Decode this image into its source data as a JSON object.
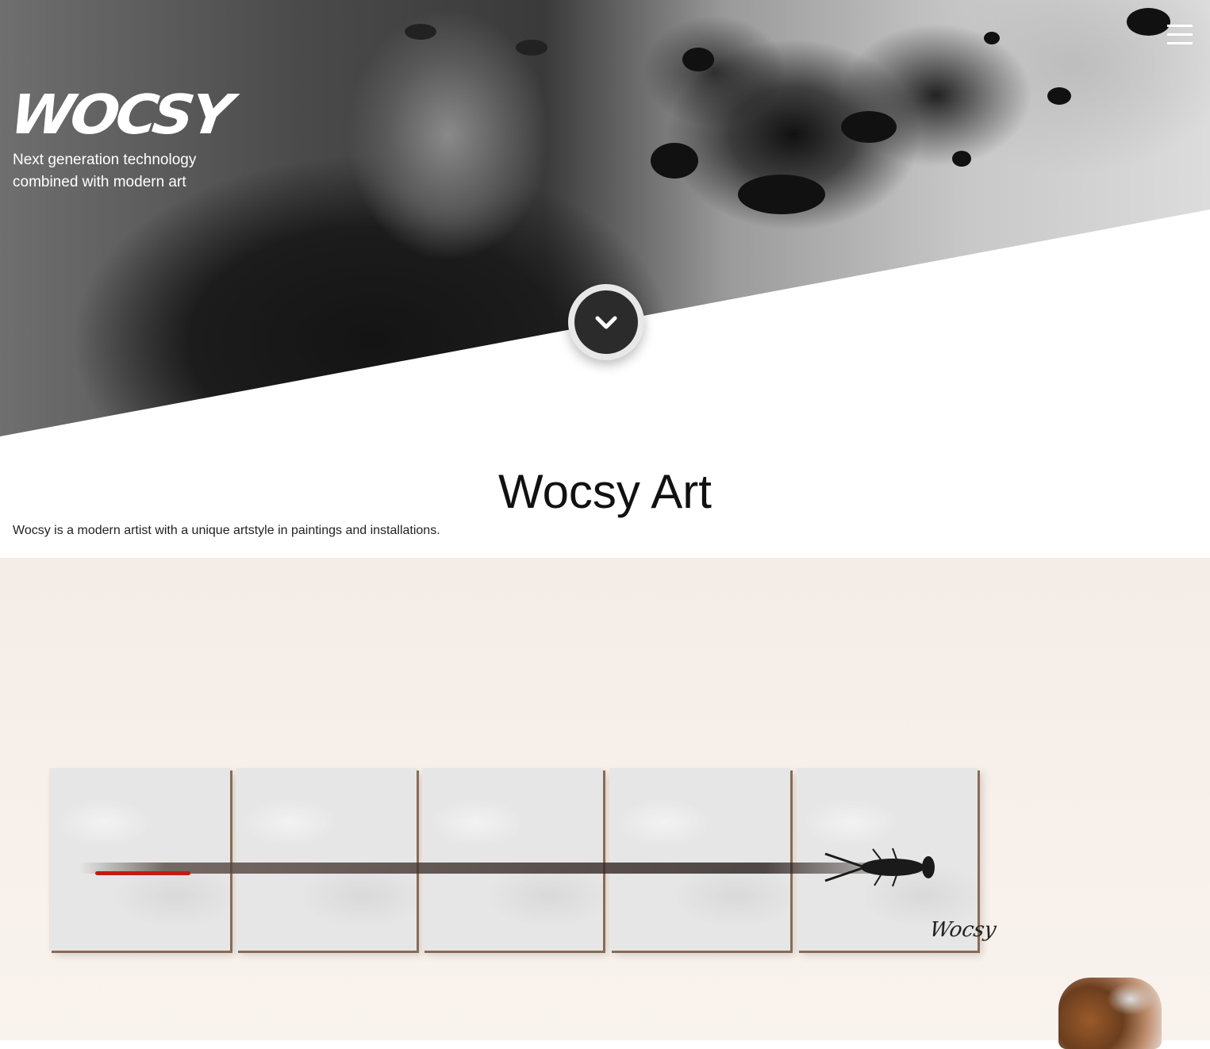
{
  "brand": {
    "logo_text": "WOCSY",
    "tagline_line1": "Next generation technology",
    "tagline_line2": "combined with modern art"
  },
  "nav": {
    "menu_icon": "hamburger-icon"
  },
  "hero": {
    "scroll_icon": "chevron-down-icon"
  },
  "intro": {
    "title": "Wocsy Art",
    "description": "Wocsy is a modern artist with a unique artstyle in paintings and installations."
  },
  "gallery": {
    "signature": "Wocsy"
  }
}
